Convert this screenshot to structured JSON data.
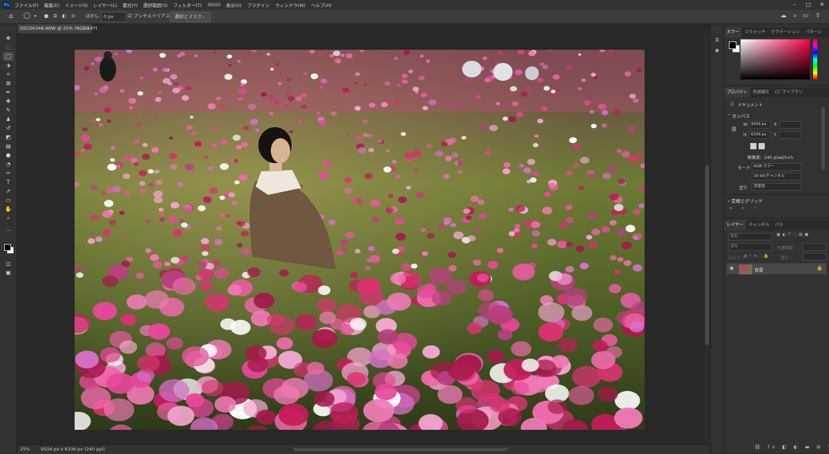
{
  "app": {
    "logo": "Ps"
  },
  "menu": [
    "ファイル(F)",
    "編集(E)",
    "イメージ(I)",
    "レイヤー(L)",
    "書式(Y)",
    "選択範囲(S)",
    "フィルター(T)",
    "3D(D)",
    "表示(V)",
    "プラグイン",
    "ウィンドウ(W)",
    "ヘルプ(H)"
  ],
  "options": {
    "feather_label": "ぼかし :",
    "feather_value": "0 px",
    "antialias_label": "アンチエイリアス",
    "antialias_checked": true,
    "select_mask_label": "選択とマスク..."
  },
  "document": {
    "tab_title": "DSC00348.ARW @ 25% (RGB/16*)",
    "zoom": "25%",
    "status": "9504 px x 6336 px (240 ppi)"
  },
  "color_panel": {
    "tabs": [
      "カラー",
      "スウォッチ",
      "グラデーション",
      "パターン"
    ],
    "foreground": "#000000",
    "background": "#ffffff",
    "picker_hue": "#ff0048"
  },
  "properties_panel": {
    "tabs": [
      "プロパティ",
      "色調補正",
      "CC ライブラリ"
    ],
    "doc_label": "ドキュメント",
    "canvas_title": "カンバス",
    "width_label": "W",
    "width_value": "9504 px",
    "height_label": "H",
    "height_value": "6336 px",
    "x_label": "X",
    "y_label": "Y",
    "resolution": "解像度：240 pixel/inch",
    "mode_label": "モード",
    "mode_value": "RGB カラー",
    "bits_value": "16 bit/チャンネル",
    "fill_label": "塗り",
    "fill_value": "背景色",
    "guides_title": "定規とグリッド"
  },
  "layers_panel": {
    "tabs": [
      "レイヤー",
      "チャンネル",
      "パス"
    ],
    "search_placeholder": "種類",
    "blend_mode": "通常",
    "opacity_label": "不透明度 :",
    "lock_label": "ロック :",
    "fill_label": "塗り :",
    "layers": [
      {
        "name": "背景",
        "visible": true,
        "locked": true
      }
    ]
  }
}
